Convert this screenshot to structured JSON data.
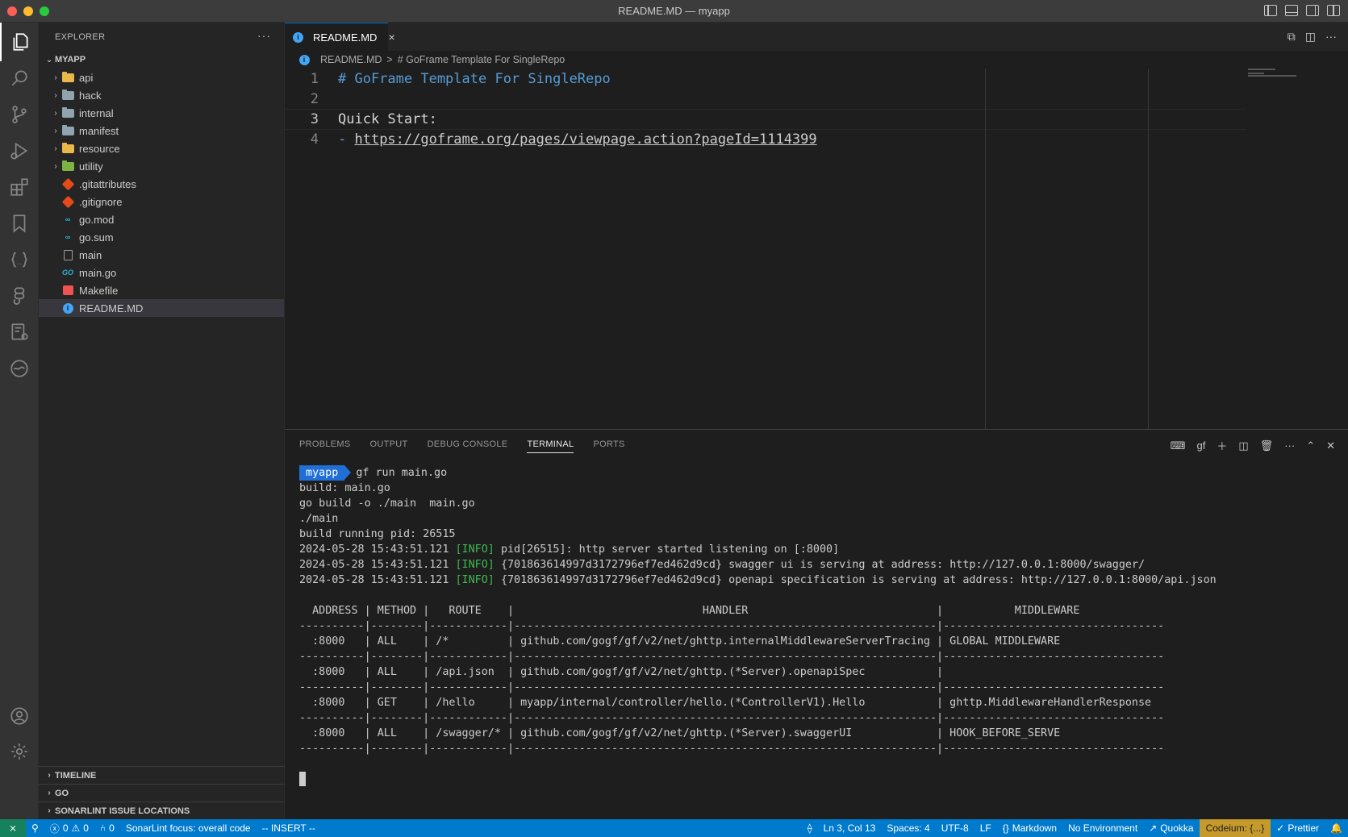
{
  "window": {
    "title": "README.MD — myapp"
  },
  "activity_bar": {
    "icons": [
      "files-icon",
      "search-icon",
      "source-control-icon",
      "run-debug-icon",
      "extensions-icon",
      "bookmark-icon",
      "json-icon",
      "figma-icon",
      "remote-explorer-icon",
      "quokka-icon",
      "account-icon",
      "settings-gear-icon"
    ]
  },
  "explorer": {
    "header": "EXPLORER",
    "more": "···",
    "project": "MYAPP",
    "items": [
      {
        "label": "api",
        "kind": "folder",
        "color": "#e8b84a"
      },
      {
        "label": "hack",
        "kind": "folder",
        "color": "#90a4ae"
      },
      {
        "label": "internal",
        "kind": "folder",
        "color": "#90a4ae"
      },
      {
        "label": "manifest",
        "kind": "folder",
        "color": "#90a4ae"
      },
      {
        "label": "resource",
        "kind": "folder",
        "color": "#e8b84a"
      },
      {
        "label": "utility",
        "kind": "folder",
        "color": "#7cb342"
      },
      {
        "label": ".gitattributes",
        "kind": "git"
      },
      {
        "label": ".gitignore",
        "kind": "git"
      },
      {
        "label": "go.mod",
        "kind": "go-mod",
        "icon_text": "∞"
      },
      {
        "label": "go.sum",
        "kind": "go-mod",
        "icon_text": "∞"
      },
      {
        "label": "main",
        "kind": "file"
      },
      {
        "label": "main.go",
        "kind": "go",
        "icon_text": "GO"
      },
      {
        "label": "Makefile",
        "kind": "makefile"
      },
      {
        "label": "README.MD",
        "kind": "info",
        "icon_text": "i",
        "selected": true
      }
    ],
    "sections": [
      "TIMELINE",
      "GO",
      "SONARLINT ISSUE LOCATIONS"
    ]
  },
  "editor": {
    "tab_label": "README.MD",
    "tab_close": "×",
    "breadcrumb": {
      "file": "README.MD",
      "separator": ">",
      "symbol": "# GoFrame Template For SingleRepo"
    },
    "lines": [
      {
        "num": "1",
        "parts": [
          {
            "cls": "md-h",
            "text": "# GoFrame Template For SingleRepo"
          }
        ]
      },
      {
        "num": "2",
        "parts": []
      },
      {
        "num": "3",
        "current": true,
        "parts": [
          {
            "cls": "md-txt",
            "text": "Quick Start:"
          }
        ]
      },
      {
        "num": "4",
        "parts": [
          {
            "cls": "md-dash",
            "text": "- "
          },
          {
            "cls": "md-link",
            "text": "https://goframe.org/pages/viewpage.action?pageId=1114399"
          }
        ]
      }
    ]
  },
  "panel": {
    "tabs": [
      {
        "label": "PROBLEMS",
        "active": false
      },
      {
        "label": "OUTPUT",
        "active": false
      },
      {
        "label": "DEBUG CONSOLE",
        "active": false
      },
      {
        "label": "TERMINAL",
        "active": true
      },
      {
        "label": "PORTS",
        "active": false
      }
    ],
    "terminal_name": "gf",
    "terminal": {
      "prompt_dir": "myapp",
      "command": "gf run main.go",
      "lines": [
        "build: main.go",
        "go build -o ./main  main.go",
        "./main",
        "build running pid: 26515"
      ],
      "log_lines": [
        {
          "ts": "2024-05-28 15:43:51.121",
          "level": "[INFO]",
          "msg": "pid[26515]: http server started listening on [:8000]"
        },
        {
          "ts": "2024-05-28 15:43:51.121",
          "level": "[INFO]",
          "msg": "{701863614997d3172796ef7ed462d9cd} swagger ui is serving at address: http://127.0.0.1:8000/swagger/"
        },
        {
          "ts": "2024-05-28 15:43:51.121",
          "level": "[INFO]",
          "msg": "{701863614997d3172796ef7ed462d9cd} openapi specification is serving at address: http://127.0.0.1:8000/api.json"
        }
      ],
      "table_lines": [
        "  ADDRESS | METHOD |   ROUTE    |                             HANDLER                             |           MIDDLEWARE             ",
        "----------|--------|------------|-----------------------------------------------------------------|----------------------------------",
        "  :8000   | ALL    | /*         | github.com/gogf/gf/v2/net/ghttp.internalMiddlewareServerTracing | GLOBAL MIDDLEWARE                ",
        "----------|--------|------------|-----------------------------------------------------------------|----------------------------------",
        "  :8000   | ALL    | /api.json  | github.com/gogf/gf/v2/net/ghttp.(*Server).openapiSpec           |                                  ",
        "----------|--------|------------|-----------------------------------------------------------------|----------------------------------",
        "  :8000   | GET    | /hello     | myapp/internal/controller/hello.(*ControllerV1).Hello           | ghttp.MiddlewareHandlerResponse  ",
        "----------|--------|------------|-----------------------------------------------------------------|----------------------------------",
        "  :8000   | ALL    | /swagger/* | github.com/gogf/gf/v2/net/ghttp.(*Server).swaggerUI             | HOOK_BEFORE_SERVE                ",
        "----------|--------|------------|-----------------------------------------------------------------|----------------------------------"
      ]
    }
  },
  "statusbar": {
    "remote": "⨯",
    "errors": "0",
    "warnings": "0",
    "ports": "0",
    "sonarlint": "SonarLint focus: overall code",
    "mode": "-- INSERT --",
    "position": "Ln 3, Col 13",
    "spaces": "Spaces: 4",
    "encoding": "UTF-8",
    "eol": "LF",
    "language": "Markdown",
    "environment": "No Environment",
    "quokka": "Quokka",
    "codeium": "Codeium: {...}",
    "prettier": "Prettier",
    "accent": "#007acc"
  }
}
